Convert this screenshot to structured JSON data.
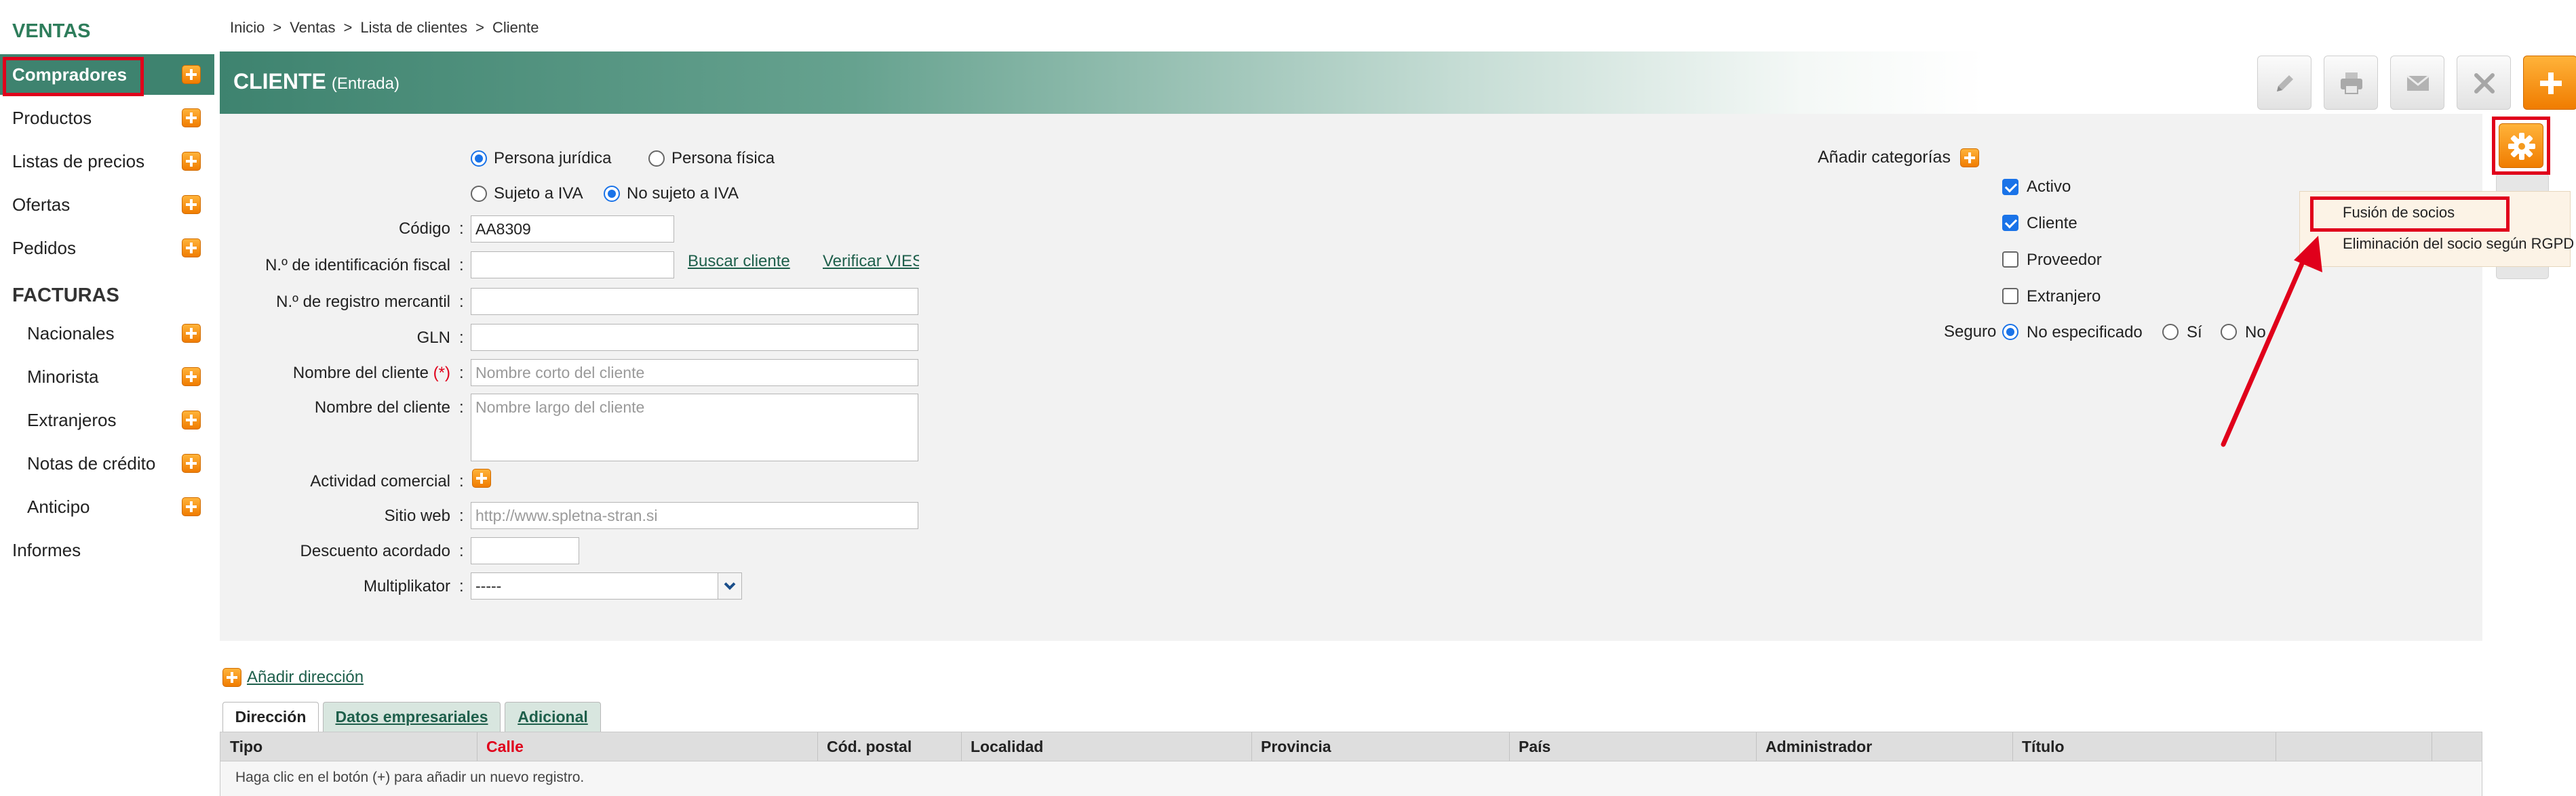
{
  "sidebar": {
    "section_ventas": "VENTAS",
    "ventas_items": [
      {
        "label": "Compradores"
      },
      {
        "label": "Productos"
      },
      {
        "label": "Listas de precios"
      },
      {
        "label": "Ofertas"
      },
      {
        "label": "Pedidos"
      }
    ],
    "section_facturas": "FACTURAS",
    "facturas_items": [
      {
        "label": "Nacionales"
      },
      {
        "label": "Minorista"
      },
      {
        "label": "Extranjeros"
      },
      {
        "label": "Notas de crédito"
      },
      {
        "label": "Anticipo"
      }
    ],
    "informes": "Informes"
  },
  "breadcrumb": [
    "Inicio",
    ">",
    "Ventas",
    ">",
    "Lista de clientes",
    ">",
    "Cliente"
  ],
  "header": {
    "title": "CLIENTE",
    "subtitle": "(Entrada)"
  },
  "form": {
    "radio_juridica": "Persona jurídica",
    "radio_fisica": "Persona física",
    "radio_sujeto": "Sujeto a IVA",
    "radio_no_sujeto": "No sujeto a IVA",
    "codigo_label": "Código",
    "codigo_value": "AA8309",
    "nif_label": "N.º de identificación fiscal",
    "buscar_cliente": "Buscar cliente",
    "verificar_vies": "Verificar VIES",
    "registro_label": "N.º de registro mercantil",
    "gln_label": "GLN",
    "nombre_corto_label": "Nombre del cliente",
    "required_mark": "(*)",
    "nombre_corto_placeholder": "Nombre corto del cliente",
    "nombre_largo_label": "Nombre del cliente",
    "nombre_largo_placeholder": "Nombre largo del cliente",
    "actividad_label": "Actividad comercial",
    "sitio_label": "Sitio web",
    "sitio_placeholder": "http://www.spletna-stran.si",
    "descuento_label": "Descuento acordado",
    "multiplikator_label": "Multiplikator",
    "multiplikator_value": "-----",
    "colon": ":"
  },
  "categories": {
    "title": "Añadir categorías",
    "items": [
      {
        "label": "Activo",
        "checked": true
      },
      {
        "label": "Cliente",
        "checked": true
      },
      {
        "label": "Proveedor",
        "checked": false
      },
      {
        "label": "Extranjero",
        "checked": false
      }
    ],
    "seguro_label": "Seguro",
    "seguro_options": [
      "No especificado",
      "Sí",
      "No"
    ]
  },
  "menu": {
    "items": [
      "Fusión de socios",
      "Eliminación del socio según RGPD"
    ]
  },
  "address": {
    "add_link": "Añadir dirección",
    "tabs": [
      "Dirección",
      "Datos empresariales",
      "Adicional"
    ],
    "columns": [
      "Tipo",
      "Calle",
      "Cód. postal",
      "Localidad",
      "Provincia",
      "País",
      "Administrador",
      "Título"
    ],
    "empty_text": "Haga clic en el botón (+) para añadir un nuevo registro."
  },
  "colors": {
    "brand": "#3e836f",
    "accent_orange": "#f7931e",
    "highlight_red": "#e0001b",
    "required": "#e0001b"
  }
}
